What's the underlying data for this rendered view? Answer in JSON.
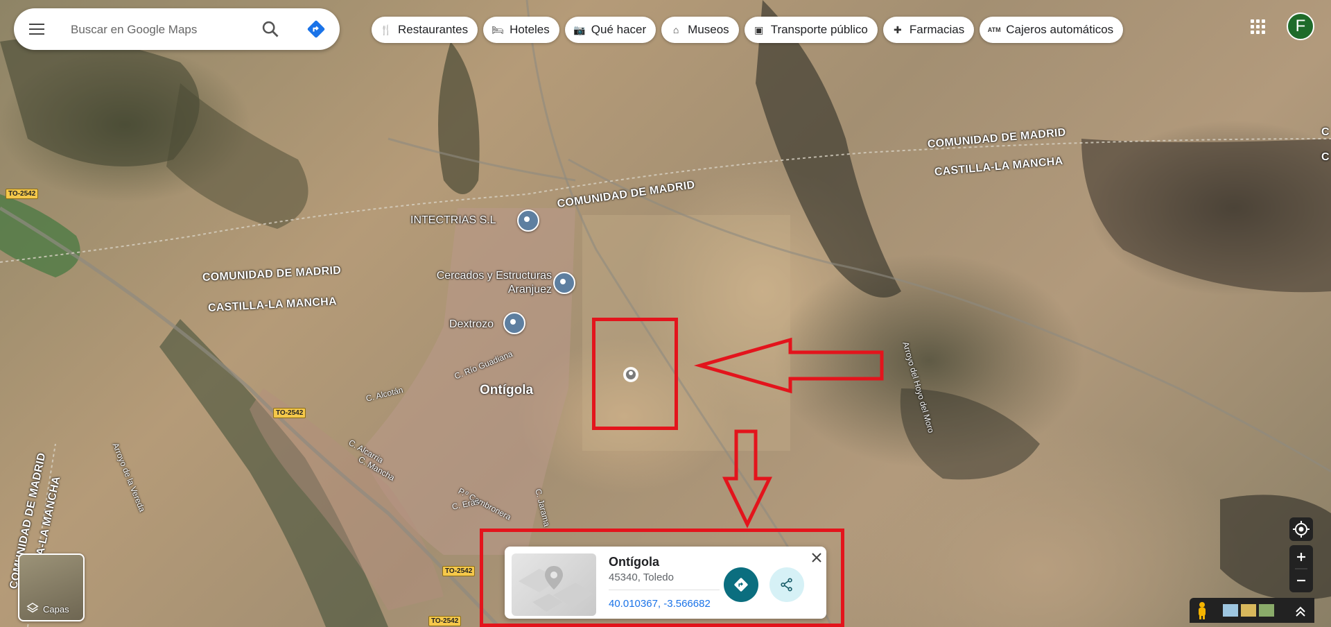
{
  "search": {
    "placeholder": "Buscar en Google Maps",
    "menu_icon": "menu-icon",
    "search_icon": "search-icon",
    "directions_icon": "directions-icon"
  },
  "chips": [
    {
      "label": "Restaurantes",
      "icon": "restaurant-icon"
    },
    {
      "label": "Hoteles",
      "icon": "hotel-icon"
    },
    {
      "label": "Qué hacer",
      "icon": "camera-icon"
    },
    {
      "label": "Museos",
      "icon": "museum-icon"
    },
    {
      "label": "Transporte público",
      "icon": "transit-icon"
    },
    {
      "label": "Farmacias",
      "icon": "pharmacy-icon"
    },
    {
      "label": "Cajeros automáticos",
      "icon": "atm-icon"
    }
  ],
  "account": {
    "initial": "F",
    "color": "#1e6b2a"
  },
  "map": {
    "region_labels": [
      "COMUNIDAD DE MADRID",
      "CASTILLA-LA MANCHA"
    ],
    "town": "Ontígola",
    "pois": [
      "INTECTRIAS S.L",
      "Cercados y Estructuras Aranjuez",
      "Dextrozo"
    ],
    "streets": [
      "C. Río Guadiana",
      "C. Alcotán",
      "C. Alcarria",
      "C. Mancha",
      "P.º Cambronera",
      "C. Eras",
      "C. Jarama"
    ],
    "waterways": [
      "Arroyo del Hoyo del Moro",
      "Arroyo de la Vereda"
    ],
    "road": "TO-2542",
    "edge_letter": "C"
  },
  "place_card": {
    "name": "Ontígola",
    "address": "45340, Toledo",
    "coordinates": "40.010367, -3.566682"
  },
  "layers": {
    "label": "Capas"
  },
  "annotation_color": "#e3141c"
}
